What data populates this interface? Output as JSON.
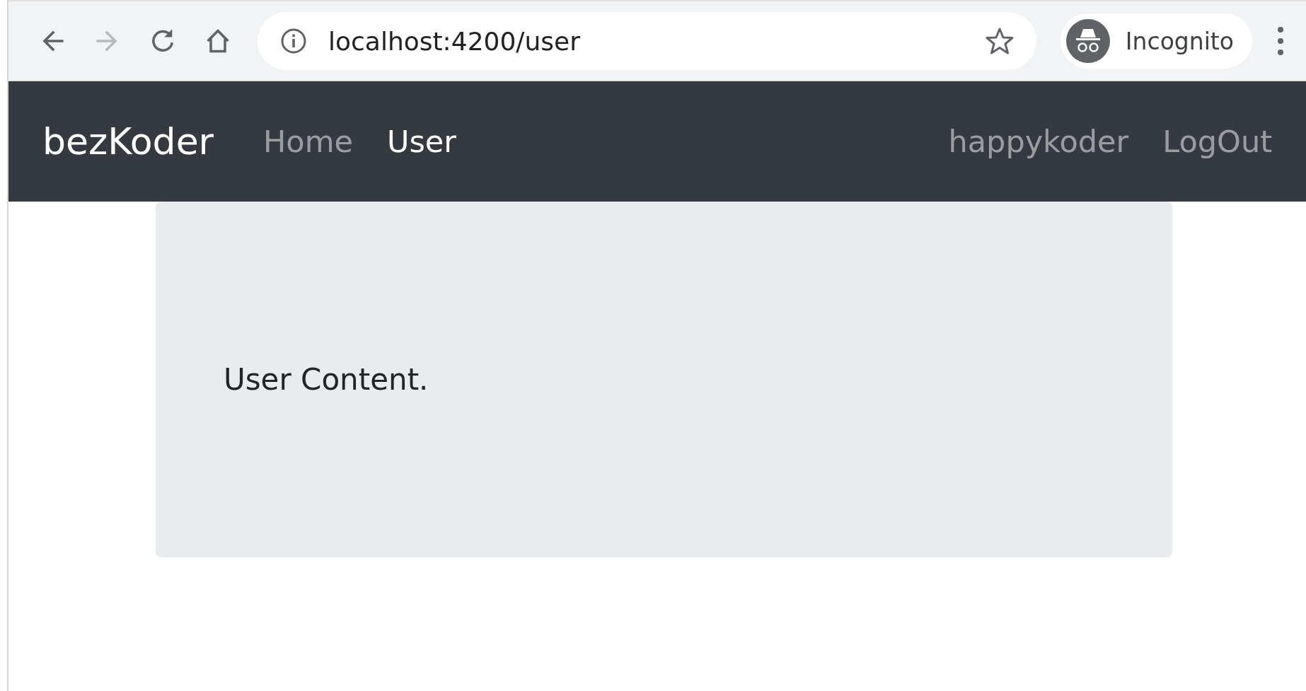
{
  "browser": {
    "buttons": [
      {
        "kind": "back",
        "disabled": false
      },
      {
        "kind": "forward",
        "disabled": true
      },
      {
        "kind": "reload",
        "disabled": false
      },
      {
        "kind": "home",
        "disabled": false
      }
    ],
    "url": "localhost:4200/user",
    "profile": "Incognito"
  },
  "navbar": {
    "brand": "bezKoder",
    "items": [
      {
        "label": "Home",
        "selected": false
      },
      {
        "label": "User",
        "selected": true
      }
    ],
    "right_items": [
      {
        "label": "happykoder"
      },
      {
        "label": "LogOut"
      }
    ]
  },
  "content": {
    "text": "User Content."
  }
}
